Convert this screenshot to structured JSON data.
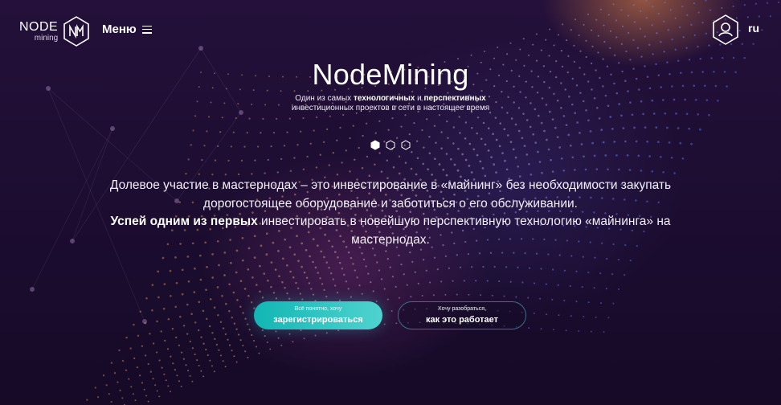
{
  "header": {
    "logo": {
      "node": "NODE",
      "mining": "mining"
    },
    "menu_label": "Меню",
    "lang": "ru"
  },
  "hero": {
    "title": "NodeMining",
    "subtitle": {
      "p1": "Один из самых ",
      "b1": "технологичных",
      "p2": " и ",
      "b2": "перспективных",
      "line2": "инвестиционных проектов в сети в настоящее время"
    },
    "slides_count": 3,
    "active_slide": 1
  },
  "description": {
    "line1": "Долевое участие в мастернодах – это инвестирование в «майнинг» без необходимости закупать дорогостоящее оборудование и заботиться о его обслуживании.",
    "bold": "Успей одним из первых",
    "line2": " инвестировать в новейшую перспективную технологию «майнинга» на мастернодах."
  },
  "buttons": {
    "register": {
      "small": "Всё понятно, хочу",
      "big": "зарегистрироваться"
    },
    "how": {
      "small": "Хочу разобраться,",
      "big": "как это работает"
    }
  },
  "colors": {
    "background": "#1b0c2e",
    "accent_teal": "#12b6b4",
    "outline_button": "#3e6e86",
    "glow_orange": "#eb8c46"
  },
  "icons": [
    "logo-hex-icon",
    "menu-icon",
    "user-hex-icon",
    "slide-dot-icon"
  ]
}
